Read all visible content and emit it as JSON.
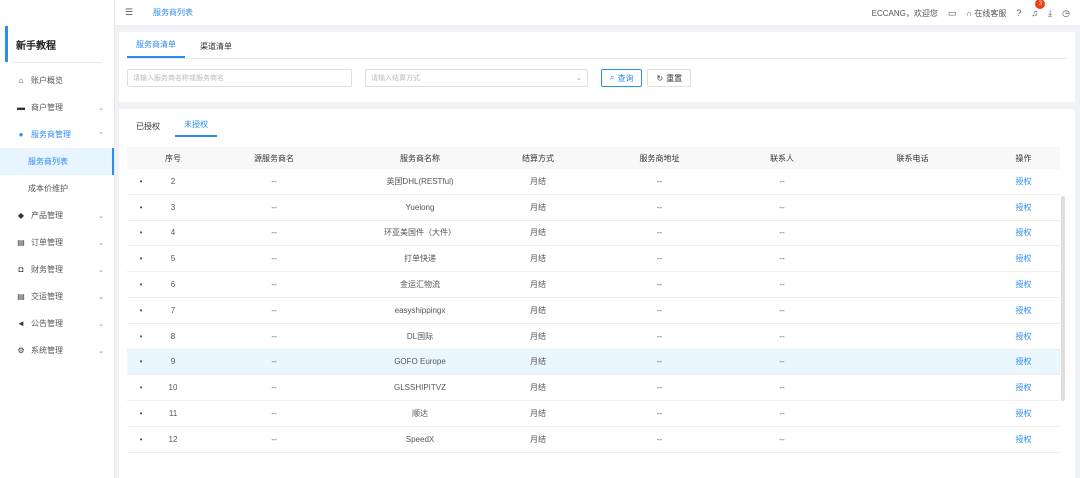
{
  "sidebar": {
    "brand": "新手教程",
    "items": [
      {
        "icon": "home-icon",
        "glyph": "⌂",
        "label": "账户概览",
        "arrow": ""
      },
      {
        "icon": "merchant-icon",
        "glyph": "▬",
        "label": "商户管理",
        "arrow": "⌄"
      },
      {
        "icon": "user-icon",
        "glyph": "●",
        "label": "服务商管理",
        "arrow": "⌃"
      },
      {
        "icon": "product-icon",
        "glyph": "◆",
        "label": "产品管理",
        "arrow": "⌄"
      },
      {
        "icon": "order-icon",
        "glyph": "▤",
        "label": "订单管理",
        "arrow": "⌄"
      },
      {
        "icon": "finance-icon",
        "glyph": "◘",
        "label": "财务管理",
        "arrow": "⌄"
      },
      {
        "icon": "shipping-icon",
        "glyph": "▤",
        "label": "交运管理",
        "arrow": "⌄"
      },
      {
        "icon": "megaphone-icon",
        "glyph": "◄",
        "label": "公告管理",
        "arrow": "⌄"
      },
      {
        "icon": "settings-icon",
        "glyph": "⚙",
        "label": "系统管理",
        "arrow": "⌄"
      }
    ],
    "sub_items": [
      "服务商列表",
      "成本价维护"
    ]
  },
  "topbar": {
    "breadcrumb": "服务商列表",
    "user": "ECCANG，欢迎您",
    "support": "在线客服",
    "badge_count": "3"
  },
  "filter_tabs": [
    "服务商清单",
    "渠道清单"
  ],
  "filters": {
    "search_placeholder": "请输入服务商名称或服务商名",
    "settle_placeholder": "请输入结算方式",
    "query_label": "查询",
    "reset_label": "重置"
  },
  "sub_tabs": [
    "已授权",
    "未授权"
  ],
  "table": {
    "headers": [
      "序号",
      "源服务商名",
      "服务商名称",
      "结算方式",
      "服务商地址",
      "联系人",
      "联系电话",
      "操作"
    ],
    "rows": [
      {
        "no": "2",
        "src": "--",
        "name": "英国DHL(RESTful)",
        "settle": "月结",
        "addr": "--",
        "contact": "--",
        "phone": "",
        "op": "授权"
      },
      {
        "no": "3",
        "src": "--",
        "name": "Yuelong",
        "settle": "月结",
        "addr": "--",
        "contact": "--",
        "phone": "",
        "op": "授权"
      },
      {
        "no": "4",
        "src": "--",
        "name": "环亚美国件（大件）",
        "settle": "月结",
        "addr": "--",
        "contact": "--",
        "phone": "",
        "op": "授权"
      },
      {
        "no": "5",
        "src": "--",
        "name": "打单快递",
        "settle": "月结",
        "addr": "--",
        "contact": "--",
        "phone": "",
        "op": "授权"
      },
      {
        "no": "6",
        "src": "--",
        "name": "金运汇物流",
        "settle": "月结",
        "addr": "--",
        "contact": "--",
        "phone": "",
        "op": "授权"
      },
      {
        "no": "7",
        "src": "--",
        "name": "easyshippingx",
        "settle": "月结",
        "addr": "--",
        "contact": "--",
        "phone": "",
        "op": "授权"
      },
      {
        "no": "8",
        "src": "--",
        "name": "DL国际",
        "settle": "月结",
        "addr": "--",
        "contact": "--",
        "phone": "",
        "op": "授权"
      },
      {
        "no": "9",
        "src": "--",
        "name": "GOFO Europe",
        "settle": "月结",
        "addr": "--",
        "contact": "--",
        "phone": "",
        "op": "授权"
      },
      {
        "no": "10",
        "src": "--",
        "name": "GLSSHIPITVZ",
        "settle": "月结",
        "addr": "--",
        "contact": "--",
        "phone": "",
        "op": "授权"
      },
      {
        "no": "11",
        "src": "--",
        "name": "顺达",
        "settle": "月结",
        "addr": "--",
        "contact": "--",
        "phone": "",
        "op": "授权"
      },
      {
        "no": "12",
        "src": "--",
        "name": "SpeedX",
        "settle": "月结",
        "addr": "--",
        "contact": "--",
        "phone": "",
        "op": "授权"
      }
    ]
  },
  "colors": {
    "accent": "#2d8cf0",
    "highlight_row": "#ebf7ff",
    "badge": "#ed4014"
  }
}
